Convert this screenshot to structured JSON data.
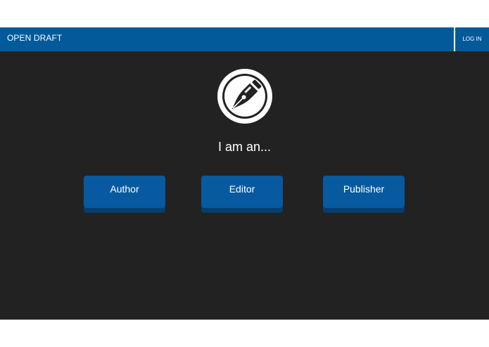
{
  "navbar": {
    "brand": "OPEN DRAFT",
    "login_label": "LOG IN",
    "color": "#035a9b"
  },
  "main": {
    "logo_icon": "fountain-pen-nib-icon",
    "prompt": "I am an...",
    "roles": [
      {
        "label": "Author"
      },
      {
        "label": "Editor"
      },
      {
        "label": "Publisher"
      }
    ],
    "background": "#222222",
    "button_color": "#075aa0"
  }
}
